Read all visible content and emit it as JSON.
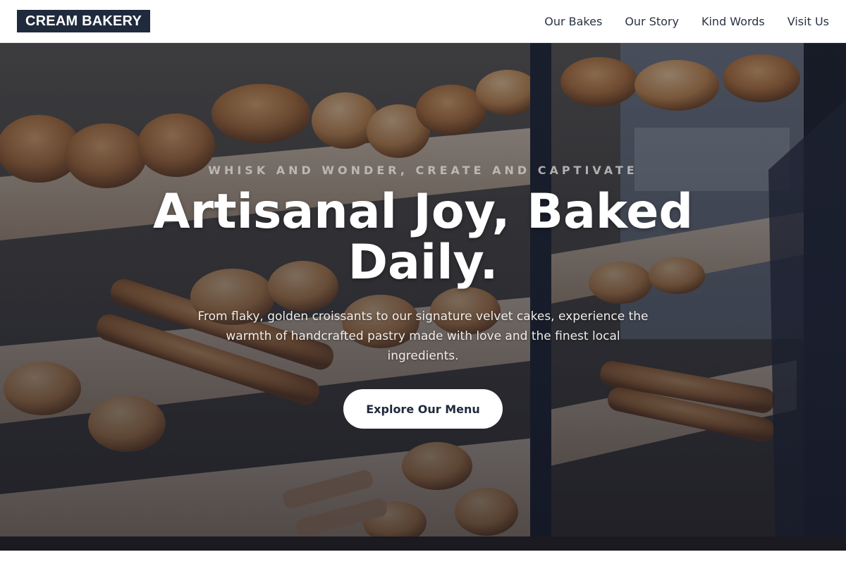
{
  "brand": {
    "name": "CREAM BAKERY"
  },
  "nav": {
    "items": [
      {
        "label": "Our Bakes"
      },
      {
        "label": "Our Story"
      },
      {
        "label": "Kind Words"
      },
      {
        "label": "Visit Us"
      }
    ]
  },
  "hero": {
    "tagline": "WHISK AND WONDER, CREATE AND CAPTIVATE",
    "headline": "Artisanal Joy, Baked Daily.",
    "subtext": "From flaky, golden croissants to our signature velvet cakes, experience the warmth of handcrafted pastry made with love and the finest local ingredients.",
    "cta_label": "Explore Our Menu",
    "background_image": "bakery-display-case-photo"
  },
  "colors": {
    "brand_navy": "#1f2a3c",
    "nav_text": "#2a3343",
    "hero_overlay": "#141826",
    "button_bg": "#ffffff"
  }
}
